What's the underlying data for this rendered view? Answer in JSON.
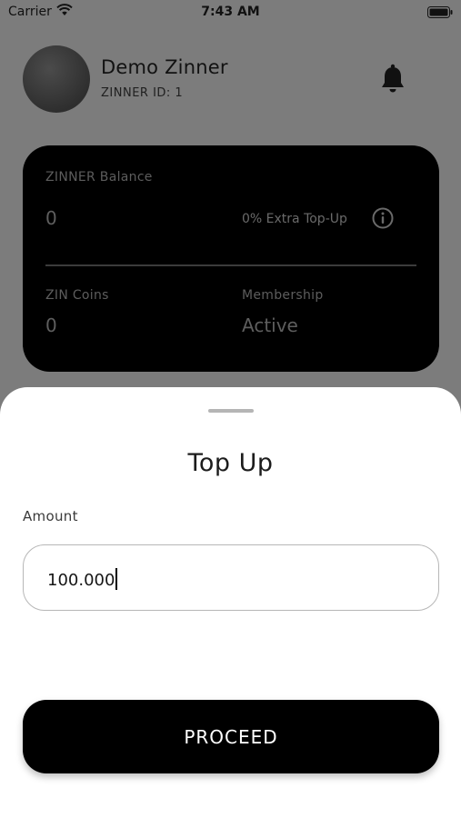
{
  "status_bar": {
    "carrier": "Carrier",
    "time": "7:43 AM",
    "wifi_icon": "wifi-icon",
    "battery_icon": "battery-icon"
  },
  "profile": {
    "name": "Demo Zinner",
    "id_text": "ZINNER ID: 1",
    "notification_icon": "bell-icon"
  },
  "balance_card": {
    "balance_label": "ZINNER Balance",
    "balance_value": "0",
    "extra_topup": "0% Extra Top-Up",
    "info_icon": "info-icon",
    "coins_label": "ZIN Coins",
    "coins_value": "0",
    "membership_label": "Membership",
    "membership_value": "Active"
  },
  "topup_sheet": {
    "title": "Top Up",
    "amount_label": "Amount",
    "amount_value": "100.000",
    "proceed_label": "PROCEED"
  },
  "colors": {
    "overlay_background": "#7c7c7c",
    "card_background": "#000000",
    "sheet_background": "#ffffff",
    "button_background": "#000000"
  }
}
